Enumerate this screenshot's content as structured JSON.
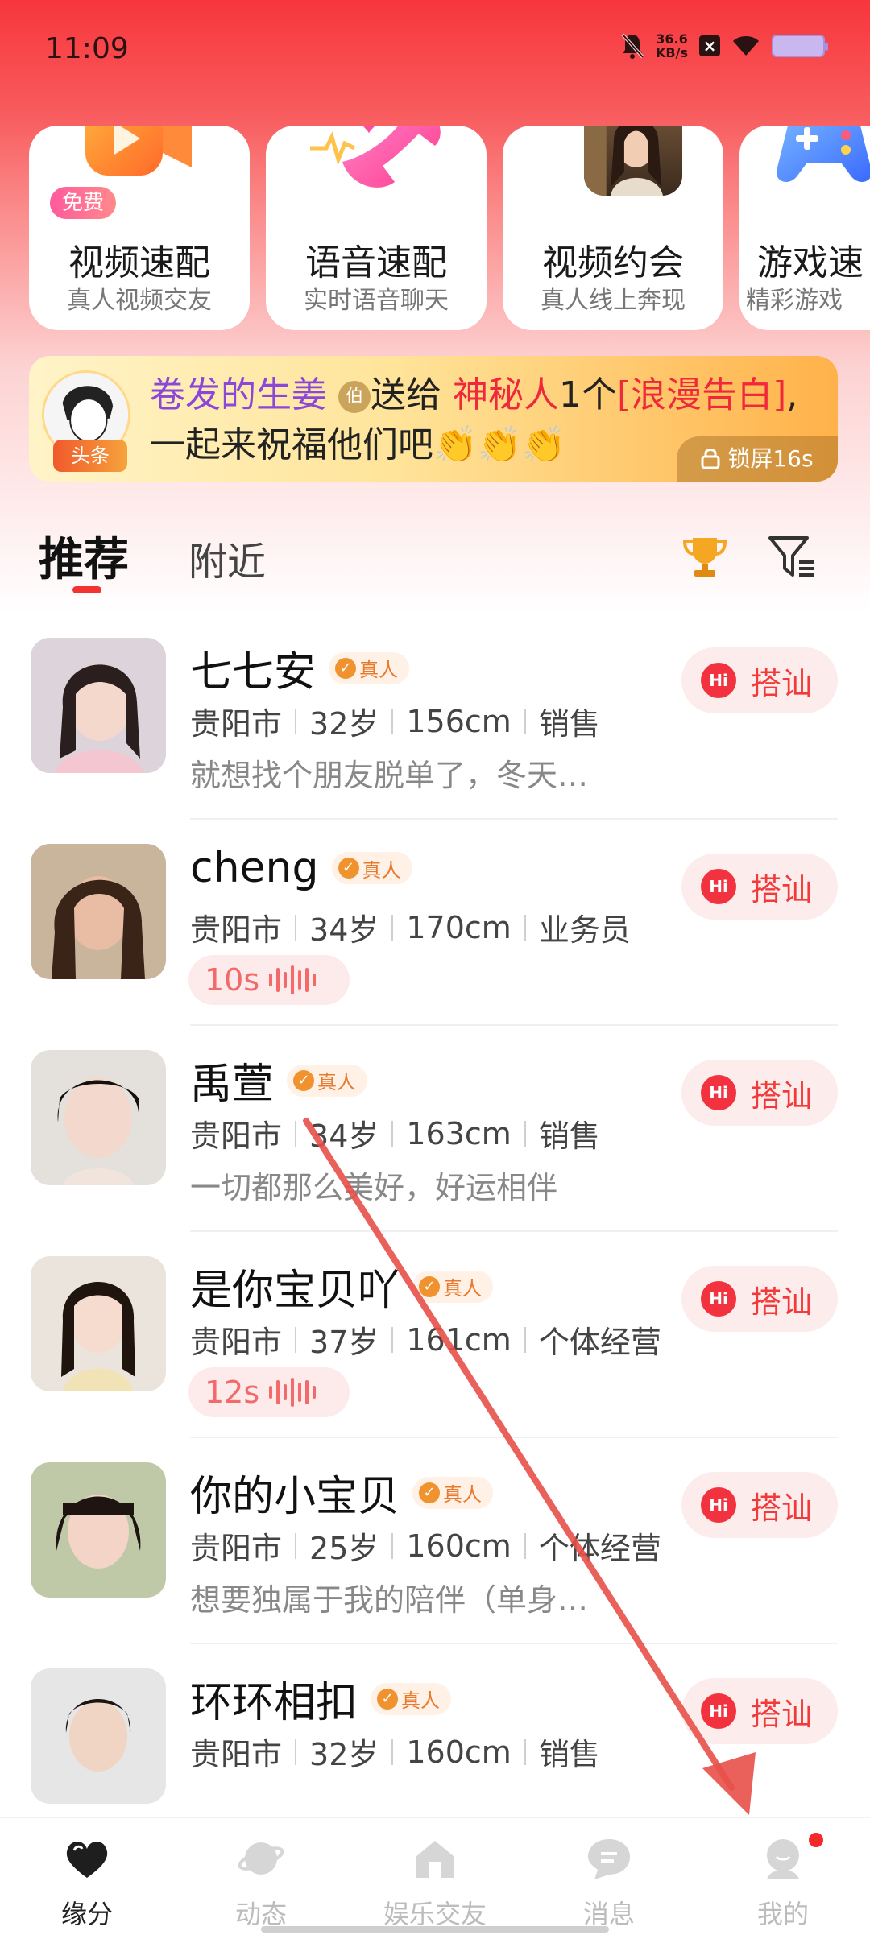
{
  "status_bar": {
    "time": "11:09",
    "net_speed_value": "36.6",
    "net_speed_unit": "KB/s"
  },
  "feature_cards": [
    {
      "title": "视频速配",
      "subtitle": "真人视频交友",
      "badge": "免费",
      "icon": "video-camera-icon"
    },
    {
      "title": "语音速配",
      "subtitle": "实时语音聊天",
      "icon": "phone-heart-icon"
    },
    {
      "title": "视频约会",
      "subtitle": "真人线上奔现",
      "icon": "profile-photo"
    },
    {
      "title": "游戏速",
      "subtitle": "精彩游戏",
      "icon": "gamepad-icon"
    }
  ],
  "banner": {
    "tag": "头条",
    "sender": "卷发的生姜",
    "level": "伯",
    "verb": "送给",
    "receiver": "神秘人",
    "count": "1个",
    "gift": "[浪漫告白]",
    "message": ",一起来祝福他们吧",
    "clap_emojis": "👏👏👏",
    "lock_label": "锁屏16s"
  },
  "tabs": {
    "recommended": "推荐",
    "nearby": "附近"
  },
  "verified_label": "真人",
  "hi_label": "搭讪",
  "users": [
    {
      "name": "七七安",
      "city": "贵阳市",
      "age": "32岁",
      "height": "156cm",
      "job": "销售",
      "bio": "就想找个朋友脱单了，冬天…"
    },
    {
      "name": "cheng",
      "city": "贵阳市",
      "age": "34岁",
      "height": "170cm",
      "job": "业务员",
      "voice": "10s"
    },
    {
      "name": "禹萱",
      "city": "贵阳市",
      "age": "34岁",
      "height": "163cm",
      "job": "销售",
      "bio": "一切都那么美好，好运相伴"
    },
    {
      "name": "是你宝贝吖",
      "city": "贵阳市",
      "age": "37岁",
      "height": "161cm",
      "job": "个体经营",
      "voice": "12s"
    },
    {
      "name": "你的小宝贝",
      "city": "贵阳市",
      "age": "25岁",
      "height": "160cm",
      "job": "个体经营",
      "bio": "想要独属于我的陪伴（单身…"
    },
    {
      "name": "环环相扣",
      "city": "贵阳市",
      "age": "32岁",
      "height": "160cm",
      "job": "销售"
    }
  ],
  "bottom_nav": [
    {
      "label": "缘分",
      "icon": "heart-icon",
      "active": true
    },
    {
      "label": "动态",
      "icon": "planet-icon"
    },
    {
      "label": "娱乐交友",
      "icon": "house-icon"
    },
    {
      "label": "消息",
      "icon": "chat-bubble-icon"
    },
    {
      "label": "我的",
      "icon": "profile-icon",
      "badge_dot": true
    }
  ],
  "colors": {
    "brand_red": "#f2333f",
    "verified_orange": "#e87a2e",
    "voice_pink": "#f26a6a"
  }
}
